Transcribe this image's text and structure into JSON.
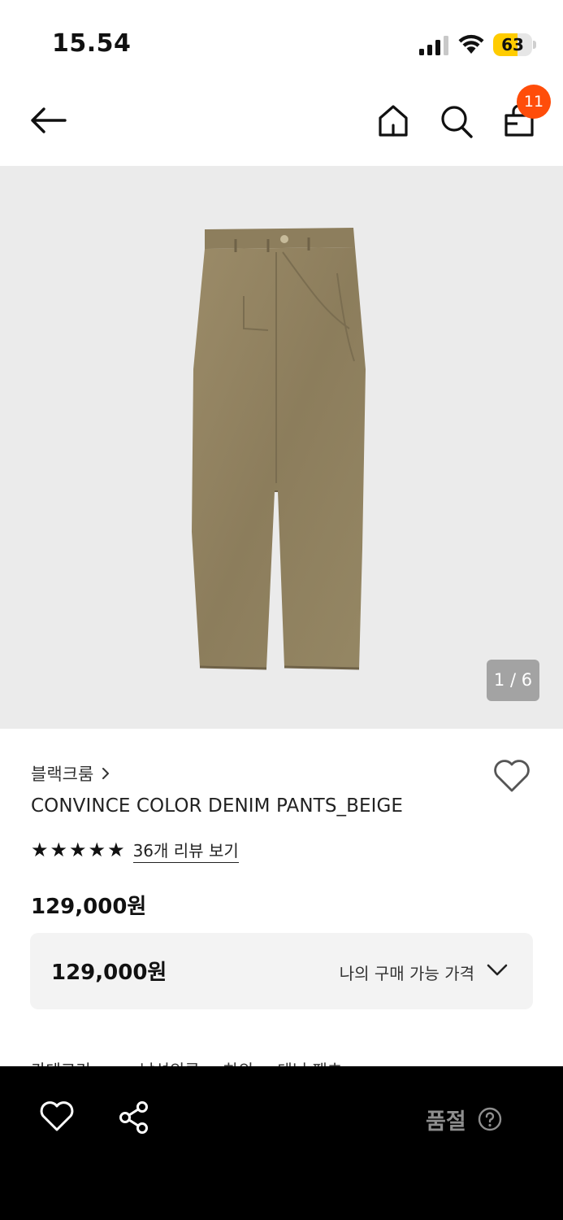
{
  "status_bar": {
    "time": "15.54",
    "battery_percent": "63",
    "battery_level": 0.63,
    "battery_color": "#ffcc00"
  },
  "header": {
    "back_icon": "arrow-left-icon",
    "home_icon": "home-icon",
    "search_icon": "search-icon",
    "cart_icon": "shopping-bag-icon",
    "cart_badge": "11",
    "badge_color": "#ff4d0a"
  },
  "gallery": {
    "image": "beige-denim-pants-photo",
    "counter": "1 / 6"
  },
  "product": {
    "brand": "블랙크룸",
    "title": "CONVINCE COLOR DENIM PANTS_BEIGE",
    "rating_stars": 5,
    "review_link": "36개 리뷰 보기",
    "price": "129,000원"
  },
  "price_box": {
    "price": "129,000원",
    "label": "나의 구매 가능 가격"
  },
  "category": {
    "label": "카테고리",
    "path": "남성의류 > 하의 > 데님 팬츠"
  },
  "bottom_bar": {
    "status": "품절",
    "heart_icon": "heart-outline-icon",
    "share_icon": "share-icon",
    "help_icon": "question-circle-icon"
  }
}
